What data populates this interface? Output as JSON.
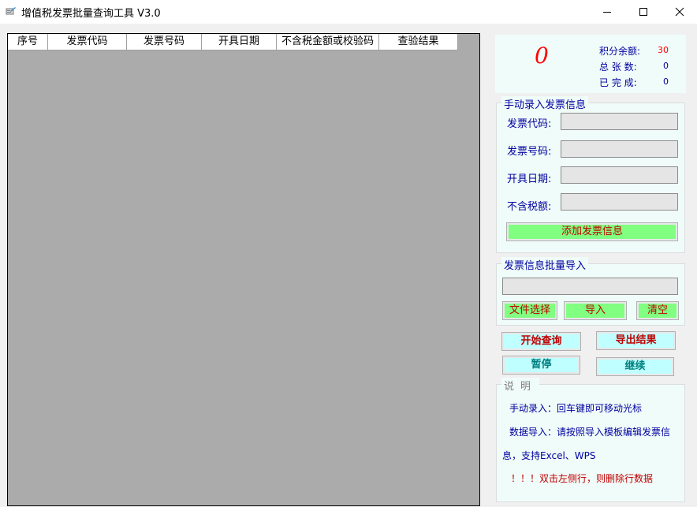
{
  "window": {
    "title": "增值税发票批量查询工具 V3.0"
  },
  "grid": {
    "columns": [
      "序号",
      "发票代码",
      "发票号码",
      "开具日期",
      "不含税金额或校验码",
      "查验结果"
    ]
  },
  "stats": {
    "big_count": "0",
    "points_label": "积分余额:",
    "points_value": "30",
    "total_label": "总 张 数:",
    "total_value": "0",
    "done_label": "已 完 成:",
    "done_value": "0"
  },
  "manual_entry": {
    "legend": "手动录入发票信息",
    "code_label": "发票代码:",
    "code_value": "",
    "number_label": "发票号码:",
    "number_value": "",
    "date_label": "开具日期:",
    "date_value": "",
    "amount_label": "不含税额:",
    "amount_value": "",
    "add_button": "添加发票信息"
  },
  "batch_import": {
    "legend": "发票信息批量导入",
    "file_path": "",
    "choose_button": "文件选择",
    "import_button": "导入",
    "clear_button": "清空"
  },
  "actions": {
    "start_button": "开始查询",
    "export_button": "导出结果",
    "pause_button": "暂停",
    "resume_button": "继续"
  },
  "notes": {
    "legend": "说明",
    "line1": "手动录入：回车键即可移动光标",
    "line2": "数据导入：请按照导入模板编辑发票信",
    "line3": "息，支持Excel、WPS",
    "line4": "！！！双击左侧行，则删除行数据"
  },
  "colors": {
    "accent_red": "#ff0000",
    "label_blue": "#0000a0",
    "button_green": "#80ff80",
    "button_cyan": "#c0ffff",
    "grid_gray": "#ababab"
  }
}
